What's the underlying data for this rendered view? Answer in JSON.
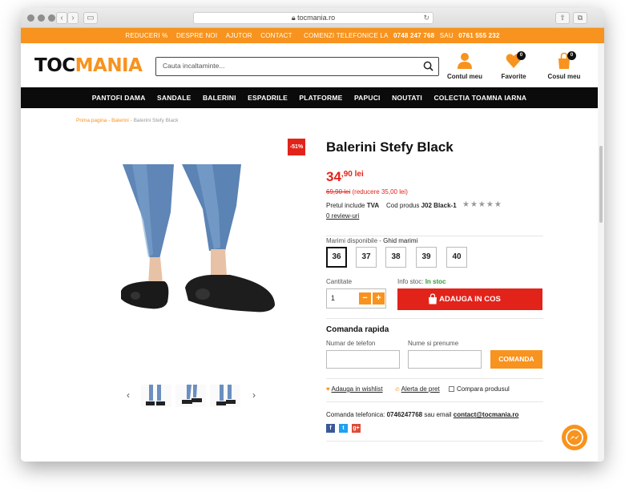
{
  "browser": {
    "url": "tocmania.ro"
  },
  "topbar": {
    "items": [
      "REDUCERI %",
      "DESPRE NOI",
      "AJUTOR",
      "CONTACT"
    ],
    "phone_text": "COMENZI TELEFONICE LA",
    "phone1": "0748 247 768",
    "sep": "SAU",
    "phone2": "0761 555 232"
  },
  "header": {
    "logo_part1": "TOC",
    "logo_part2": "MANIA",
    "search_placeholder": "Cauta incaltaminte...",
    "account_label": "Contul meu",
    "favorites_label": "Favorite",
    "favorites_count": "0",
    "cart_label": "Cosul meu",
    "cart_count": "0"
  },
  "nav": [
    "PANTOFI DAMA",
    "SANDALE",
    "BALERINI",
    "ESPADRILE",
    "PLATFORME",
    "PAPUCI",
    "NOUTATI",
    "COLECTIA TOAMNA IARNA"
  ],
  "breadcrumb": {
    "home": "Prima pagina",
    "sep1": " - ",
    "category": "Balerini",
    "sep2": " - ",
    "current": "Balerini Stefy Black"
  },
  "product": {
    "discount": "-51%",
    "title": "Balerini Stefy Black",
    "price_int": "34",
    "price_dec": ",90 lei",
    "old_price": "69,90 lei",
    "savings": "(reducere 35,00 lei)",
    "vat_label": "Pretul include",
    "vat_value": "TVA",
    "code_label": "Cod produs",
    "code_value": "J02 Black-1",
    "stars": "★★★★★",
    "reviews": "0 review-uri",
    "sizes_label": "Marimi disponibile - ",
    "size_guide": "Ghid marimi",
    "sizes": [
      "36",
      "37",
      "38",
      "39",
      "40"
    ],
    "selected_size": "36",
    "qty_label": "Cantitate",
    "qty_value": "1",
    "qty_minus": "−",
    "qty_plus": "+",
    "stock_label": "Info stoc: ",
    "stock_value": "In stoc",
    "add_to_cart": "ADAUGA IN COS"
  },
  "quick_order": {
    "title": "Comanda rapida",
    "phone_label": "Numar de telefon",
    "name_label": "Nume si prenume",
    "phone_value": "",
    "name_value": "",
    "button": "COMANDA"
  },
  "actions": {
    "wishlist": "Adauga in wishlist",
    "alert": "Alerta de pret",
    "compare": "Compara produsul"
  },
  "contact": {
    "phone_label": "Comanda telefonica: ",
    "phone": "0746247768",
    "email_label": " sau email ",
    "email": "contact@tocmania.ro"
  },
  "social": {
    "facebook": "f",
    "twitter": "t",
    "google": "g+"
  },
  "colors": {
    "accent": "#f7931e",
    "sale": "#e2231a",
    "nav_bg": "#0b0b0b",
    "in_stock": "#2ea02e"
  }
}
